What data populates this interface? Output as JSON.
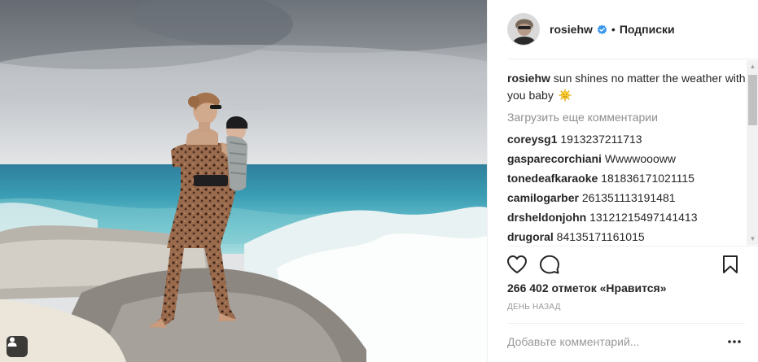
{
  "post": {
    "username": "rosiehw",
    "follow_separator": "•",
    "follow_label": "Подписки",
    "caption_user": "rosiehw",
    "caption_text": "sun shines no matter the weather with you baby",
    "caption_emoji": "sun-with-face-icon",
    "load_more": "Загрузить еще комментарии",
    "comments": [
      {
        "user": "coreysg1",
        "text": "1913237211713"
      },
      {
        "user": "gasparecorchiani",
        "text": "Wwwwoooww"
      },
      {
        "user": "tonedeafkaraoke",
        "text": "181836171021115"
      },
      {
        "user": "camilogarber",
        "text": "261351113191481"
      },
      {
        "user": "drsheldonjohn",
        "text": "13121215497141413"
      },
      {
        "user": "drugoral",
        "text": "84135171161015"
      }
    ],
    "likes": "266 402 отметок «Нравится»",
    "time_ago": "День назад",
    "add_comment_placeholder": "Добавьте комментарий...",
    "icons": {
      "like": "heart-icon",
      "comment": "comment-bubble-icon",
      "save": "bookmark-icon",
      "options": "more-options-icon",
      "verified": "verified-badge-icon",
      "tag": "user-tag-icon"
    },
    "colors": {
      "verified": "#3897f0",
      "text": "#262626",
      "muted": "#999999",
      "border": "#efefef"
    }
  }
}
